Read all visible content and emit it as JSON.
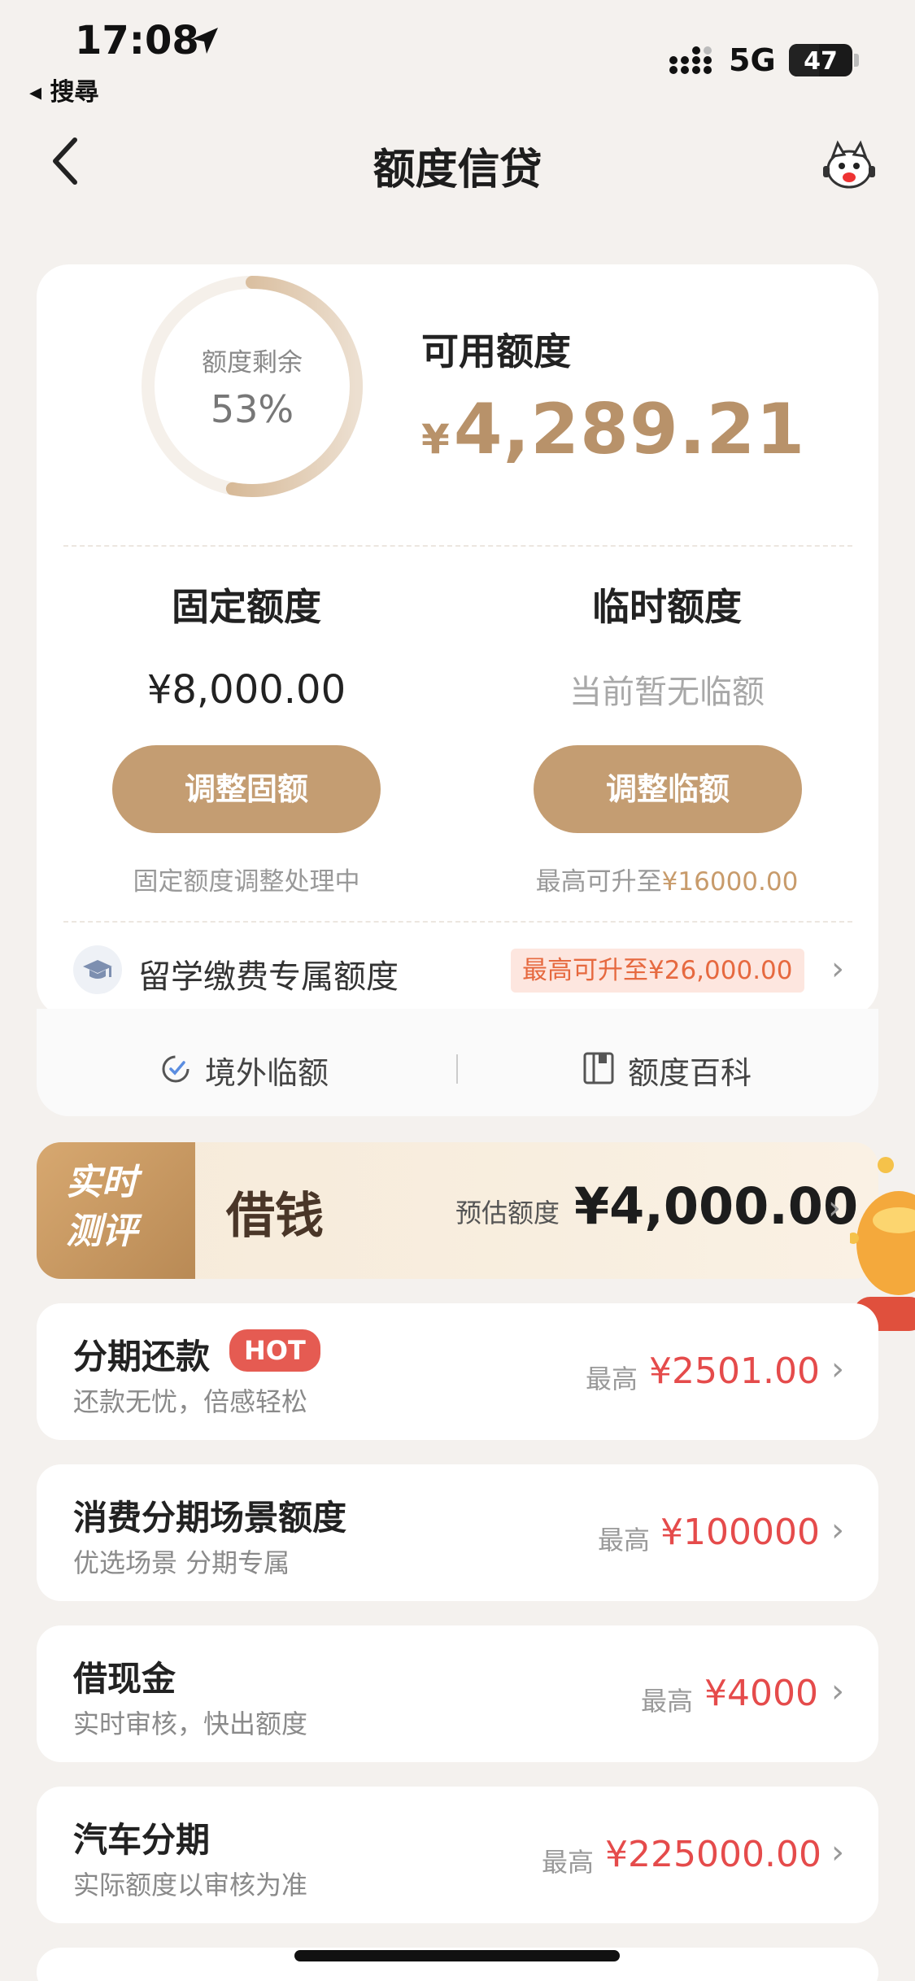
{
  "status": {
    "time": "17:08",
    "back_app": "◂ 搜尋",
    "network": "5G",
    "battery": "47"
  },
  "nav": {
    "title": "额度信贷"
  },
  "credit": {
    "ring_label": "额度剩余",
    "ring_percent": "53%",
    "ring_fraction": 0.53,
    "available_label": "可用额度",
    "available_currency": "¥",
    "available_amount": "4,289.21",
    "fixed": {
      "title": "固定额度",
      "amount": "¥8,000.00",
      "button": "调整固额",
      "note": "固定额度调整处理中"
    },
    "temp": {
      "title": "临时额度",
      "status": "当前暂无临额",
      "button": "调整临额",
      "note_prefix": "最高可升至",
      "note_value": "¥16000.00"
    },
    "abroad": {
      "label": "留学缴费专属额度",
      "badge": "最高可升至¥26,000.00"
    },
    "footer": {
      "left": "境外临额",
      "right": "额度百科"
    }
  },
  "borrow": {
    "tag_line1": "实时",
    "tag_line2": "测评",
    "title": "借钱",
    "estimate_label": "预估额度",
    "estimate_amount": "¥4,000.00"
  },
  "items": [
    {
      "title": "分期还款",
      "badge": "HOT",
      "subtitle": "还款无忧，倍感轻松",
      "max_label": "最高",
      "value": "¥2501.00"
    },
    {
      "title": "消费分期场景额度",
      "subtitle": "优选场景 分期专属",
      "max_label": "最高",
      "value": "¥100000"
    },
    {
      "title": "借现金",
      "subtitle": "实时审核，快出额度",
      "max_label": "最高",
      "value": "¥4000"
    },
    {
      "title": "汽车分期",
      "subtitle": "实际额度以审核为准",
      "max_label": "最高",
      "value": "¥225000.00"
    }
  ],
  "colors": {
    "accent_gold": "#c49d72",
    "accent_red": "#e54b4b",
    "badge_orange": "#e6693f"
  }
}
